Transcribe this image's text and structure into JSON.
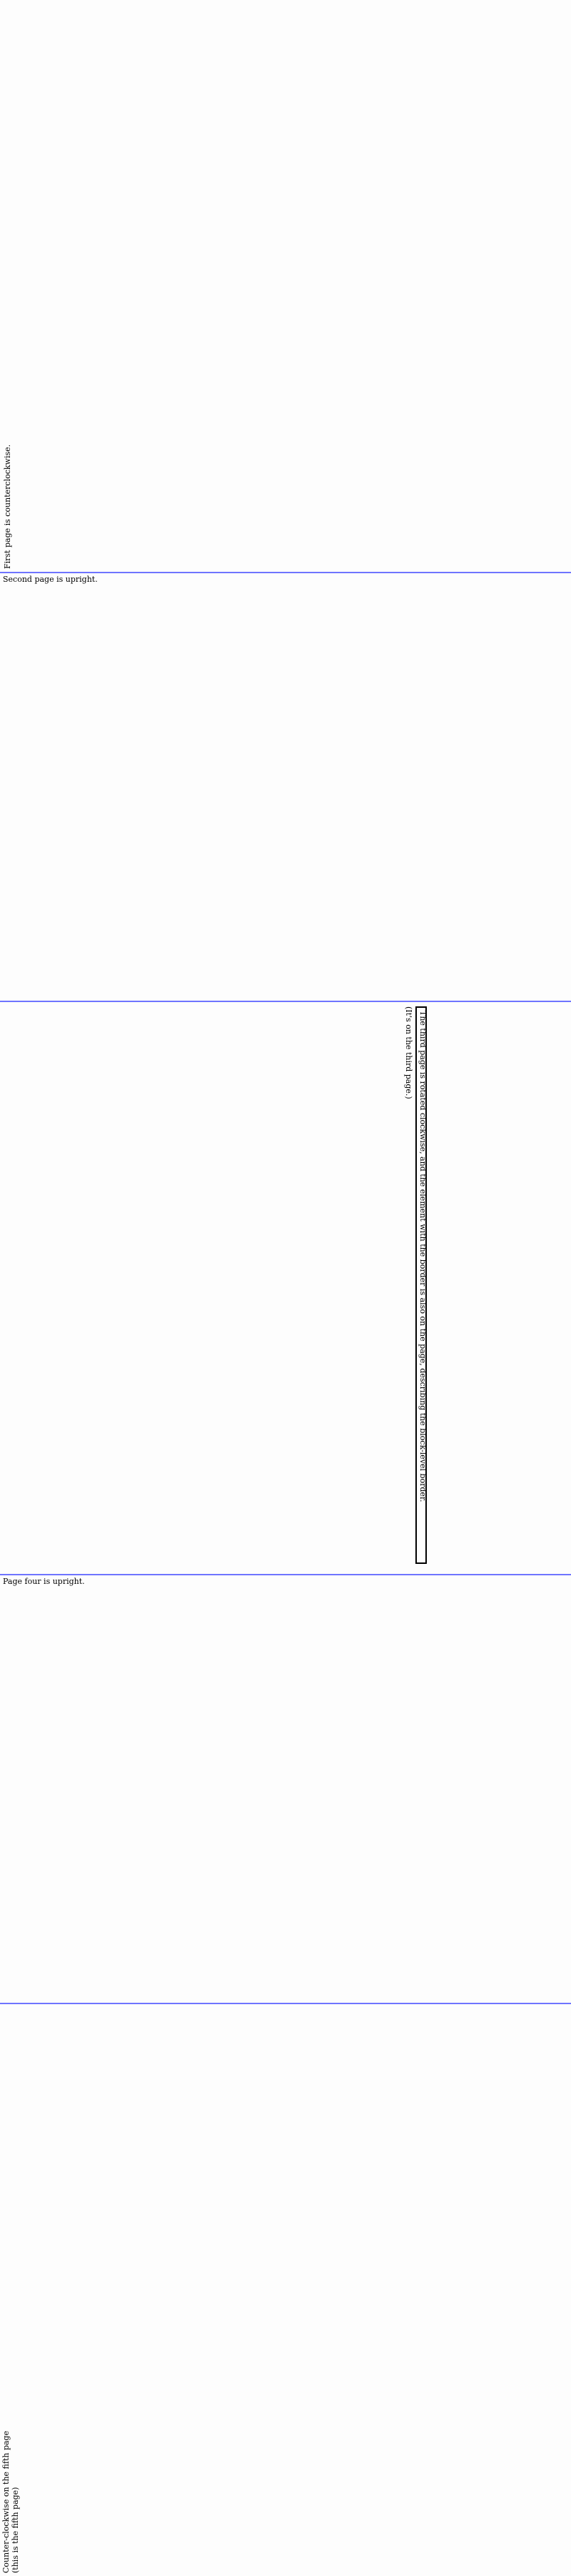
{
  "pages": {
    "p1": {
      "text": "First page is counterclockwise."
    },
    "p2": {
      "text": "Second page is upright."
    },
    "p3": {
      "box_text": "The third page is rotated clockwise, and the element with the border is also on the page, describing the block-level border.",
      "note_text": "(It's on the third page.)"
    },
    "p4": {
      "text": "Page four is upright."
    },
    "p5": {
      "line1": "Counter-clockwise on the fifth page",
      "line2": "(this is the fifth page)"
    }
  },
  "colors": {
    "separator": "#6f74ff",
    "page_background": "#fdfdfd",
    "text": "#000000"
  }
}
